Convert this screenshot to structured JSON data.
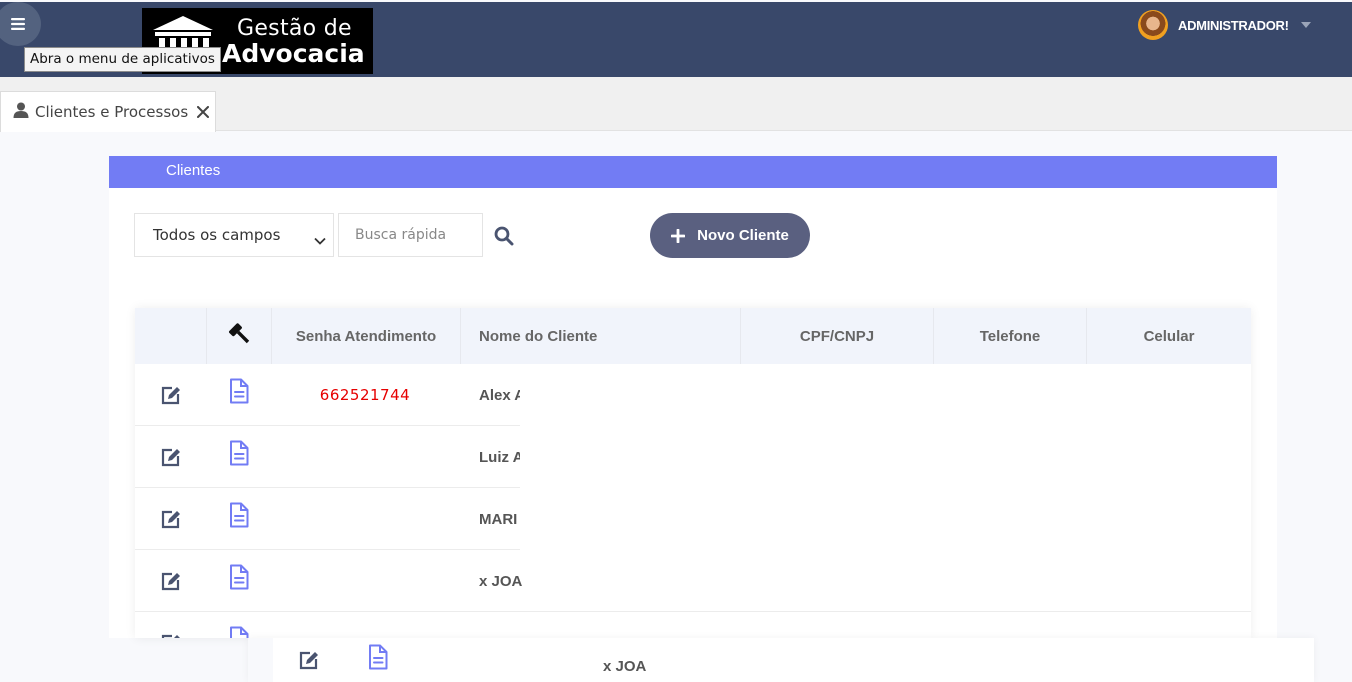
{
  "header": {
    "logo_line1": "Gestão de",
    "logo_line2": "Advocacia",
    "menu_tooltip": "Abra o menu de aplicativos",
    "user_name": "ADMINISTRADOR!",
    "bar_color": "#39486a"
  },
  "tabs": [
    {
      "label": "Clientes e Processos",
      "icon": "user-icon"
    }
  ],
  "panel": {
    "title": "Clientes",
    "header_color": "#727cf4"
  },
  "toolbar": {
    "filter_selected": "Todos os campos",
    "search_placeholder": "Busca rápida",
    "new_button_label": "Novo Cliente"
  },
  "table": {
    "columns": [
      "",
      "",
      "Senha Atendimento",
      "Nome do Cliente",
      "CPF/CNPJ",
      "Telefone",
      "Celular"
    ],
    "column_icons": {
      "processos": "gavel-icon"
    },
    "rows": [
      {
        "senha": "662521744",
        "nome": "Alex A"
      },
      {
        "senha": "",
        "nome": "Luiz A"
      },
      {
        "senha": "",
        "nome": "MARI"
      },
      {
        "senha": "",
        "nome": "x JOA"
      }
    ],
    "dragged_row": {
      "nome": "x JOA"
    },
    "accent_color": "#727cf4",
    "senha_color": "#e60000"
  }
}
